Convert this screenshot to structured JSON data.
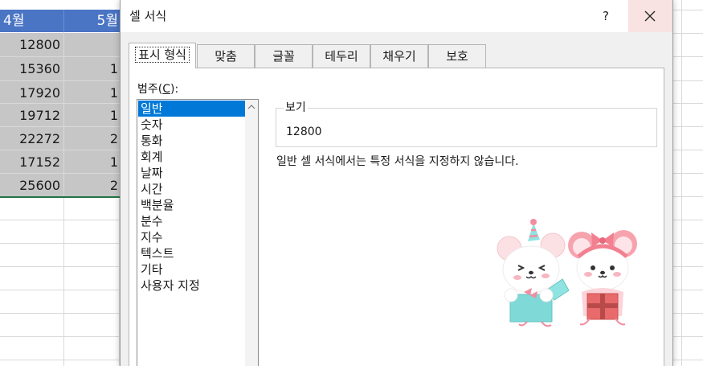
{
  "sheet": {
    "headers": [
      "4월",
      "5월"
    ],
    "rows": [
      [
        "12800",
        ""
      ],
      [
        "15360",
        "1"
      ],
      [
        "17920",
        "1"
      ],
      [
        "19712",
        "1"
      ],
      [
        "22272",
        "2"
      ],
      [
        "17152",
        "1"
      ],
      [
        "25600",
        "2"
      ]
    ]
  },
  "dialog": {
    "title": "셀 서식",
    "help_label": "?",
    "tabs": [
      "표시 형식",
      "맞춤",
      "글꼴",
      "테두리",
      "채우기",
      "보호"
    ],
    "active_tab": 0,
    "category_label_prefix": "범주(",
    "category_label_key": "C",
    "category_label_suffix": "):",
    "categories": [
      "일반",
      "숫자",
      "통화",
      "회계",
      "날짜",
      "시간",
      "백분율",
      "분수",
      "지수",
      "텍스트",
      "기타",
      "사용자 지정"
    ],
    "selected_category": 0,
    "sample_label": "보기",
    "sample_value": "12800",
    "description": "일반 셀 서식에서는 특정 서식을 지정하지 않습니다.",
    "colors": {
      "header_blue": "#4a74c4",
      "selection_blue": "#0078d7",
      "close_hover": "#f8e2e2",
      "selected_cells": "#c6c6c6",
      "active_border": "#217346"
    }
  }
}
